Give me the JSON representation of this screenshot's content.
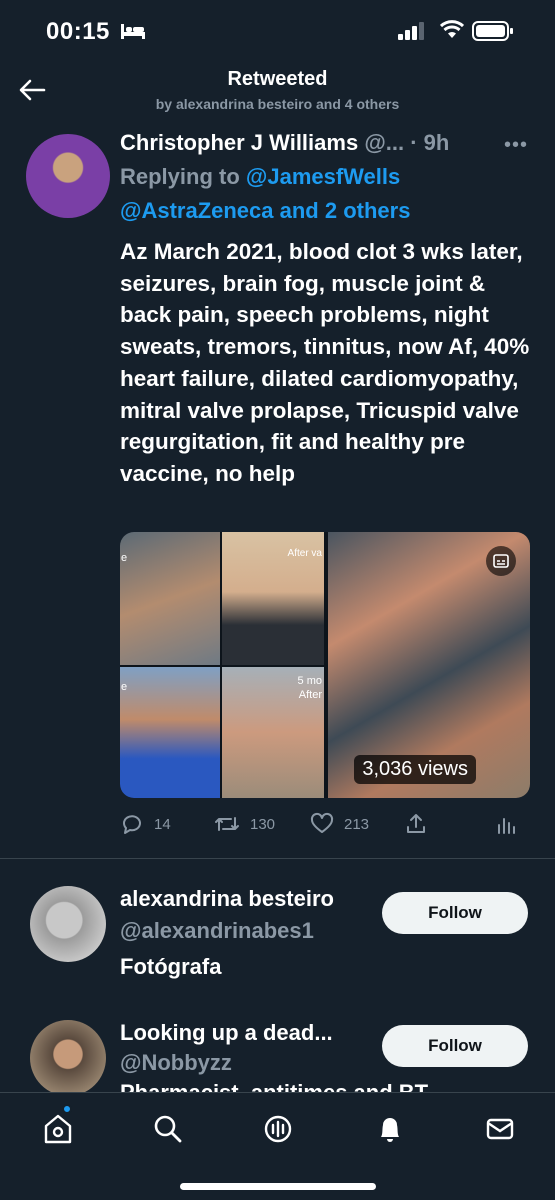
{
  "status": {
    "time": "00:15"
  },
  "header": {
    "title": "Retweeted",
    "subtitle": "by alexandrina besteiro and 4 others"
  },
  "tweet": {
    "author_name": "Christopher J Williams",
    "author_meta": "@... · 9h",
    "replying_prefix": "Replying to ",
    "replying_mention1": "@JamesfWells",
    "replying_line2": "@AstraZeneca and 2 others",
    "text": "Az March 2021, blood clot 3 wks later, seizures, brain fog, muscle joint & back pain, speech problems, night sweats, tremors, tinnitus, now Af, 40% heart failure, dilated cardiomyopathy, mitral valve prolapse, Tricuspid valve regurgitation, fit and healthy pre vaccine, no help",
    "media": {
      "views": "3,036 views",
      "caption_after": "After va",
      "caption_5mo": "5 mo",
      "caption_after2": "After",
      "caption_e1": "e",
      "caption_e2": "e"
    },
    "actions": {
      "replies": "14",
      "retweets": "130",
      "likes": "213"
    }
  },
  "users": [
    {
      "name": "alexandrina besteiro",
      "handle": "@alexandrinabes1",
      "bio": "Fotógrafa",
      "follow_label": "Follow"
    },
    {
      "name": "Looking up a dead...",
      "handle": "@Nobbyzz",
      "bio": "Pharmacist, antitimes and BT...",
      "follow_label": "Follow"
    }
  ],
  "colors": {
    "background": "#15202b",
    "accent": "#1d9bf0",
    "secondary_text": "#8b98a5",
    "divider": "#38444d"
  },
  "icons": {
    "back": "back-arrow-icon",
    "more": "more-icon",
    "reply": "reply-icon",
    "retweet": "retweet-icon",
    "like": "heart-icon",
    "share": "share-icon",
    "stats": "stats-icon",
    "tabs": [
      "home-icon",
      "search-icon",
      "spaces-icon",
      "notifications-icon",
      "messages-icon"
    ]
  }
}
